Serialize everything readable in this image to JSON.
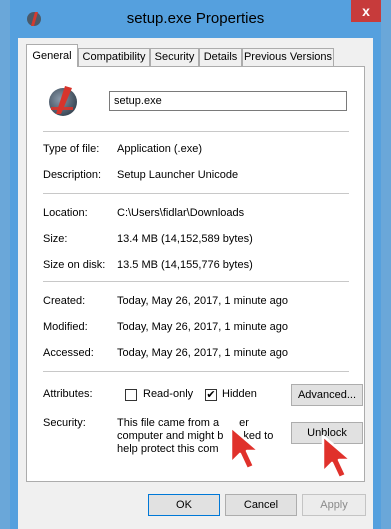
{
  "window": {
    "title": "setup.exe Properties",
    "close_label": "x"
  },
  "tabs": [
    {
      "label": "General",
      "active": true
    },
    {
      "label": "Compatibility",
      "active": false
    },
    {
      "label": "Security",
      "active": false
    },
    {
      "label": "Details",
      "active": false
    },
    {
      "label": "Previous Versions",
      "active": false
    }
  ],
  "file": {
    "name": "setup.exe",
    "type_label": "Type of file:",
    "type_value": "Application (.exe)",
    "description_label": "Description:",
    "description_value": "Setup Launcher Unicode",
    "location_label": "Location:",
    "location_value": "C:\\Users\\fidlar\\Downloads",
    "size_label": "Size:",
    "size_value": "13.4 MB (14,152,589 bytes)",
    "size_on_disk_label": "Size on disk:",
    "size_on_disk_value": "13.5 MB (14,155,776 bytes)",
    "created_label": "Created:",
    "created_value": "Today, May 26, 2017, 1 minute ago",
    "modified_label": "Modified:",
    "modified_value": "Today, May 26, 2017, 1 minute ago",
    "accessed_label": "Accessed:",
    "accessed_value": "Today, May 26, 2017, 1 minute ago"
  },
  "attributes": {
    "label": "Attributes:",
    "readonly_label": "Read-only",
    "readonly_checked": false,
    "hidden_label": "Hidden",
    "hidden_checked": true,
    "hidden_mark": "✔",
    "advanced_label": "Advanced..."
  },
  "security": {
    "label": "Security:",
    "line1": "This file came from a",
    "line1b": "er",
    "line2": "computer and might b",
    "line2b": "ked to",
    "line3": "help protect this com",
    "unblock_label": "Unblock"
  },
  "footer": {
    "ok_label": "OK",
    "cancel_label": "Cancel",
    "apply_label": "Apply"
  },
  "colors": {
    "titlebar": "#55a0de",
    "close": "#c73b3b",
    "cursor": "#e0312b"
  },
  "icons": {
    "title": "app-logo-icon",
    "app": "app-logo-icon",
    "cursor": "arrow-cursor-icon"
  }
}
